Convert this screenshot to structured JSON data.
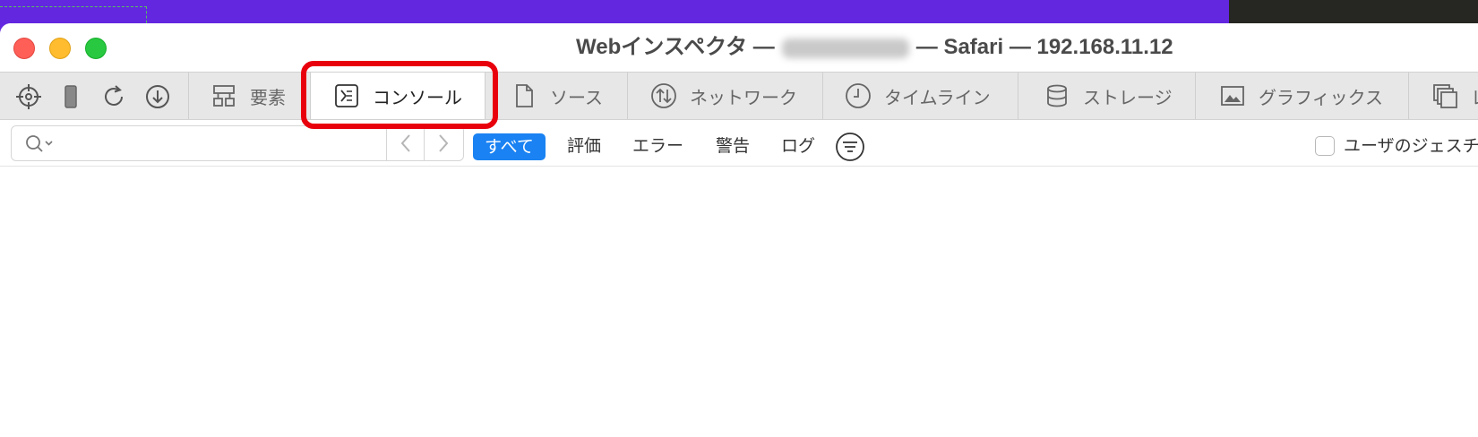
{
  "window": {
    "title_prefix": "Webインスペクタ —",
    "title_suffix": "— Safari — 192.168.11.12"
  },
  "toolbar": {
    "icons": [
      "crosshair-icon",
      "device-icon",
      "reload-icon",
      "download-icon"
    ]
  },
  "tabs": [
    {
      "label": "要素",
      "icon": "elements-icon"
    },
    {
      "label": "コンソール",
      "icon": "console-icon",
      "active": true
    },
    {
      "label": "ソース",
      "icon": "sources-icon"
    },
    {
      "label": "ネットワーク",
      "icon": "network-icon"
    },
    {
      "label": "タイムライン",
      "icon": "timeline-icon"
    },
    {
      "label": "ストレージ",
      "icon": "storage-icon"
    },
    {
      "label": "グラフィックス",
      "icon": "graphics-icon"
    },
    {
      "label": "レ",
      "icon": "layers-icon"
    }
  ],
  "filter": {
    "search_value": "",
    "search_placeholder": "",
    "buttons": [
      {
        "label": "すべて",
        "active": true
      },
      {
        "label": "評価"
      },
      {
        "label": "エラー"
      },
      {
        "label": "警告"
      },
      {
        "label": "ログ"
      }
    ],
    "checkbox_label": "ユーザのジェスチ",
    "checkbox_checked": false
  },
  "colors": {
    "accent": "#1a82f2",
    "highlight": "#e8000d",
    "desktop": "#6327e0"
  }
}
